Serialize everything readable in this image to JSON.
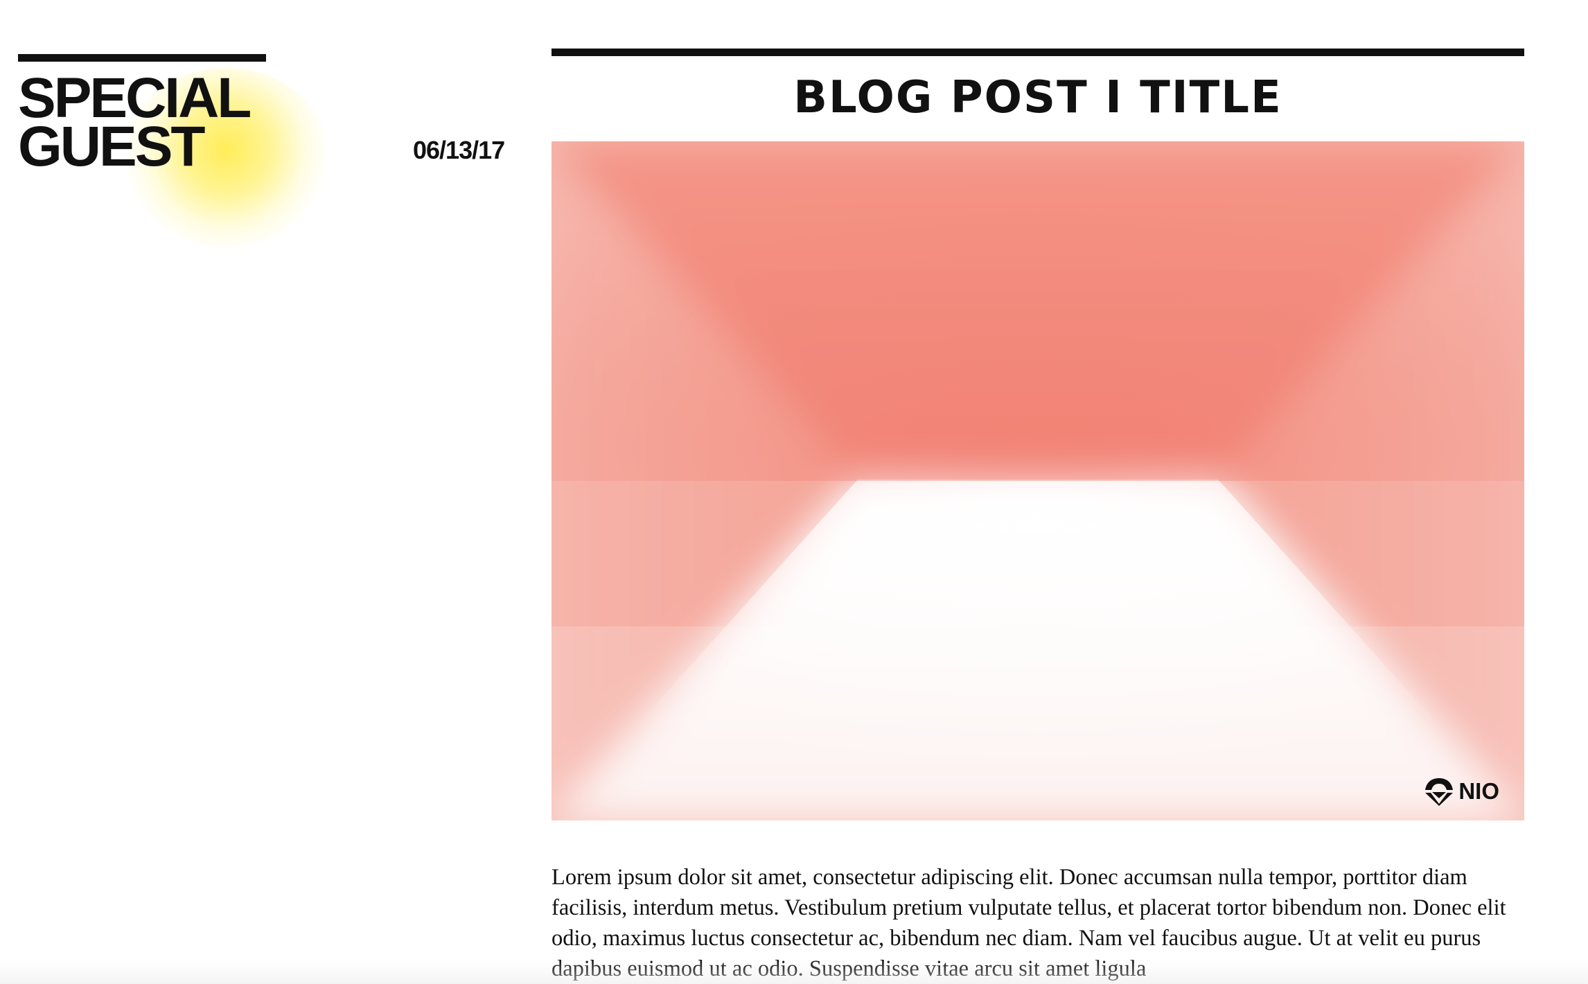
{
  "brand": {
    "line1": "SPECIAL",
    "line2": "GUEST",
    "accent_color": "#ffec50"
  },
  "post": {
    "date": "06/13/17",
    "title": "BLOG POST I TITLE",
    "body": "Lorem ipsum dolor sit amet, consectetur adipiscing elit. Donec accumsan nulla tempor, porttitor diam facilisis, interdum metus. Vestibulum pretium vulputate tellus, et placerat tortor bibendum non. Donec elit odio, maximus luctus consectetur ac, bibendum nec diam. Nam vel faucibus augue. Ut at velit eu purus dapibus euismod ut ac odio. Suspendisse vitae arcu sit amet ligula"
  },
  "hero": {
    "colors": {
      "top": "#f28a7c",
      "sides": "#f5aea3",
      "bottom_center": "#ffffff"
    },
    "logo": {
      "icon": "nio-logo-icon",
      "text": "NIO"
    }
  }
}
